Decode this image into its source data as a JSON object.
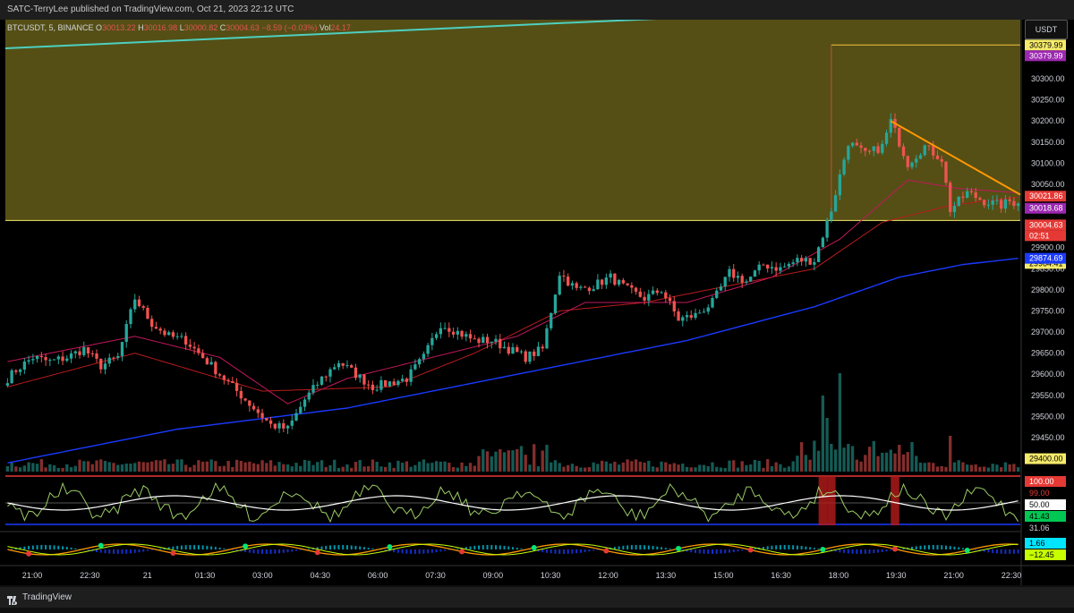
{
  "header": {
    "publish_text": "SATC-TerryLee published on TradingView.com, Oct 21, 2023 22:12 UTC"
  },
  "symbol": {
    "name": "BTCUSDT, 5, BINANCE",
    "o_label": "O",
    "o_value": "30013.22",
    "h_label": "H",
    "h_value": "30016.98",
    "l_label": "L",
    "l_value": "30000.82",
    "c_label": "C",
    "c_value": "30004.63",
    "change": "−8.59 (−0.03%)",
    "vol_label": "Vol",
    "vol_value": "24.17"
  },
  "currency_button": "USDT",
  "footer": {
    "brand": "TradingView"
  },
  "colors": {
    "up": "#26a69a",
    "down": "#ef5350",
    "zone": "#5a5316",
    "ema_fast": "#c2185b",
    "ema_mid": "#b71c1c",
    "ema_slow": "#1a3aff",
    "triangle": "#ff9800",
    "rsi_line": "#ffffff"
  },
  "chart_data": {
    "type": "candlestick",
    "symbol": "BTCUSDT",
    "interval": "5",
    "exchange": "BINANCE",
    "ylim": [
      29380,
      30440
    ],
    "y_ticks": [
      "30350.00",
      "30300.00",
      "30250.00",
      "30200.00",
      "30150.00",
      "30100.00",
      "30050.00",
      "29900.00",
      "29850.00",
      "29800.00",
      "29750.00",
      "29700.00",
      "29650.00",
      "29600.00",
      "29550.00",
      "29500.00",
      "29450.00"
    ],
    "x_tick_labels": [
      "21:00",
      "22:30",
      "21",
      "01:30",
      "03:00",
      "04:30",
      "06:00",
      "07:30",
      "09:00",
      "10:30",
      "12:00",
      "13:30",
      "15:00",
      "16:30",
      "18:00",
      "19:30",
      "21:00",
      "22:30"
    ],
    "price_anchors": [
      [
        0,
        29590
      ],
      [
        2,
        29610
      ],
      [
        6,
        29640
      ],
      [
        10,
        29630
      ],
      [
        14,
        29640
      ],
      [
        18,
        29660
      ],
      [
        22,
        29620
      ],
      [
        26,
        29640
      ],
      [
        30,
        29780
      ],
      [
        34,
        29720
      ],
      [
        38,
        29690
      ],
      [
        42,
        29680
      ],
      [
        46,
        29640
      ],
      [
        50,
        29600
      ],
      [
        54,
        29560
      ],
      [
        58,
        29520
      ],
      [
        62,
        29480
      ],
      [
        66,
        29470
      ],
      [
        70,
        29540
      ],
      [
        74,
        29590
      ],
      [
        78,
        29630
      ],
      [
        82,
        29600
      ],
      [
        86,
        29570
      ],
      [
        90,
        29580
      ],
      [
        94,
        29590
      ],
      [
        98,
        29640
      ],
      [
        102,
        29720
      ],
      [
        106,
        29700
      ],
      [
        110,
        29680
      ],
      [
        114,
        29680
      ],
      [
        118,
        29660
      ],
      [
        122,
        29640
      ],
      [
        126,
        29660
      ],
      [
        130,
        29840
      ],
      [
        134,
        29800
      ],
      [
        138,
        29810
      ],
      [
        142,
        29830
      ],
      [
        146,
        29800
      ],
      [
        150,
        29780
      ],
      [
        154,
        29800
      ],
      [
        158,
        29730
      ],
      [
        162,
        29740
      ],
      [
        166,
        29770
      ],
      [
        170,
        29840
      ],
      [
        174,
        29820
      ],
      [
        178,
        29860
      ],
      [
        182,
        29850
      ],
      [
        186,
        29870
      ],
      [
        190,
        29870
      ],
      [
        194,
        29990
      ],
      [
        198,
        30150
      ],
      [
        202,
        30120
      ],
      [
        206,
        30140
      ],
      [
        208,
        30200
      ],
      [
        212,
        30100
      ],
      [
        216,
        30140
      ],
      [
        220,
        30110
      ],
      [
        222,
        29990
      ],
      [
        226,
        30030
      ],
      [
        230,
        30010
      ],
      [
        234,
        30000
      ],
      [
        236,
        30010
      ],
      [
        238,
        30004.63
      ]
    ],
    "ema_fast_anchors": [
      [
        0,
        29630
      ],
      [
        30,
        29690
      ],
      [
        50,
        29640
      ],
      [
        66,
        29530
      ],
      [
        80,
        29590
      ],
      [
        100,
        29640
      ],
      [
        120,
        29690
      ],
      [
        136,
        29770
      ],
      [
        160,
        29770
      ],
      [
        180,
        29830
      ],
      [
        196,
        29920
      ],
      [
        212,
        30060
      ],
      [
        224,
        30040
      ],
      [
        238,
        30030
      ]
    ],
    "ema_mid_anchors": [
      [
        0,
        29570
      ],
      [
        30,
        29650
      ],
      [
        60,
        29560
      ],
      [
        90,
        29570
      ],
      [
        110,
        29650
      ],
      [
        130,
        29750
      ],
      [
        150,
        29770
      ],
      [
        170,
        29810
      ],
      [
        190,
        29850
      ],
      [
        206,
        29960
      ],
      [
        222,
        30000
      ],
      [
        238,
        30020
      ]
    ],
    "ema_slow_anchors": [
      [
        0,
        29390
      ],
      [
        40,
        29470
      ],
      [
        80,
        29520
      ],
      [
        120,
        29600
      ],
      [
        160,
        29680
      ],
      [
        190,
        29760
      ],
      [
        210,
        29830
      ],
      [
        225,
        29860
      ],
      [
        238,
        29874.69
      ]
    ],
    "supply_zone": {
      "top": 30440,
      "bottom": 29964.41
    },
    "zone_top_line": 30379.99,
    "triangle_line": {
      "from": [
        208,
        30200
      ],
      "to": [
        238,
        30028
      ]
    },
    "right_labels": [
      {
        "price": 30379.99,
        "text": "30379.99",
        "bg": "#f5ea6a",
        "fg": "#000000"
      },
      {
        "price": 30379.99,
        "text": "30379.99",
        "bg": "#9c27b0",
        "fg": "#ffffff",
        "offset": 1
      },
      {
        "price": 30021.86,
        "text": "30021.86",
        "bg": "#e53935",
        "fg": "#ffffff"
      },
      {
        "price": 30018.68,
        "text": "30018.68",
        "bg": "#9c27b0",
        "fg": "#ffffff",
        "offset": 1
      },
      {
        "price": 30004.63,
        "text": "30004.63",
        "bg": "#e53935",
        "fg": "#ffffff",
        "offset": 2
      },
      {
        "price": 30004.63,
        "text": "02:51",
        "bg": "#e53935",
        "fg": "#ffffff",
        "offset": 3
      },
      {
        "price": 29964.41,
        "text": "29964.41",
        "bg": "#f5ea6a",
        "fg": "#000000",
        "offset": 4
      },
      {
        "price": 29874.69,
        "text": "29874.69",
        "bg": "#1a3aff",
        "fg": "#ffffff"
      },
      {
        "price": 29400.0,
        "text": "29400.00",
        "bg": "#f5ea6a",
        "fg": "#000000"
      }
    ],
    "rsi_panel": {
      "levels": {
        "upper": 100.0,
        "lower": 31.06
      },
      "labels": [
        {
          "text": "100.00",
          "bg": "#e53935",
          "fg": "#ffffff"
        },
        {
          "text": "99.00",
          "bg": "#000000",
          "fg": "#e53935"
        },
        {
          "text": "50.00",
          "bg": "#ffffff",
          "fg": "#000000"
        },
        {
          "text": "41.43",
          "bg": "#00c853",
          "fg": "#000000"
        },
        {
          "text": "31.06",
          "bg": "#000000",
          "fg": "#d1d4dc"
        }
      ]
    },
    "osc_panel": {
      "labels": [
        {
          "text": "1.66",
          "bg": "#00e5ff",
          "fg": "#000000"
        },
        {
          "text": "−12.45",
          "bg": "#c6ff00",
          "fg": "#000000"
        }
      ]
    }
  }
}
